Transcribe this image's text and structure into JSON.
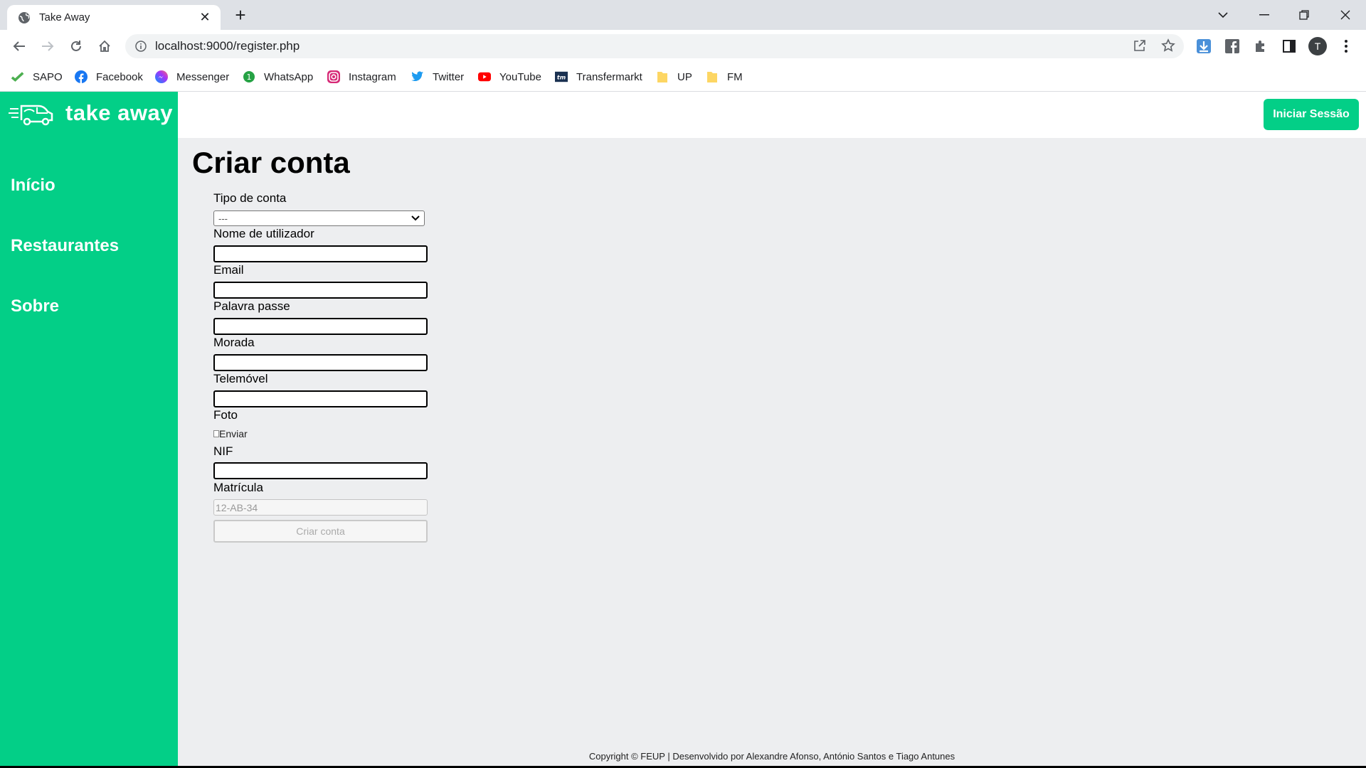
{
  "browser": {
    "tab_title": "Take Away",
    "url": "localhost:9000/register.php",
    "profile_initial": "T",
    "bookmarks": [
      {
        "label": "SAPO",
        "icon": "sapo-icon"
      },
      {
        "label": "Facebook",
        "icon": "facebook-icon"
      },
      {
        "label": "Messenger",
        "icon": "messenger-icon"
      },
      {
        "label": "WhatsApp",
        "icon": "whatsapp-icon"
      },
      {
        "label": "Instagram",
        "icon": "instagram-icon"
      },
      {
        "label": "Twitter",
        "icon": "twitter-icon"
      },
      {
        "label": "YouTube",
        "icon": "youtube-icon"
      },
      {
        "label": "Transfermarkt",
        "icon": "transfermarkt-icon"
      },
      {
        "label": "UP",
        "icon": "folder-icon"
      },
      {
        "label": "FM",
        "icon": "folder-icon"
      }
    ]
  },
  "site": {
    "brand": "take away",
    "accent": "#03cf87",
    "menu": [
      "Início",
      "Restaurantes",
      "Sobre"
    ],
    "login_button": "Iniciar Sessão"
  },
  "form": {
    "title": "Criar conta",
    "account_type_label": "Tipo de conta",
    "account_type_value": "---",
    "username_label": "Nome de utilizador",
    "email_label": "Email",
    "password_label": "Palavra passe",
    "address_label": "Morada",
    "phone_label": "Telemóvel",
    "photo_label": "Foto",
    "photo_alt": "Enviar",
    "nif_label": "NIF",
    "plate_label": "Matrícula",
    "plate_placeholder": "12-AB-34",
    "submit_label": "Criar conta"
  },
  "footer": {
    "text": "Copyright © FEUP | Desenvolvido por Alexandre Afonso, António Santos e Tiago Antunes"
  }
}
